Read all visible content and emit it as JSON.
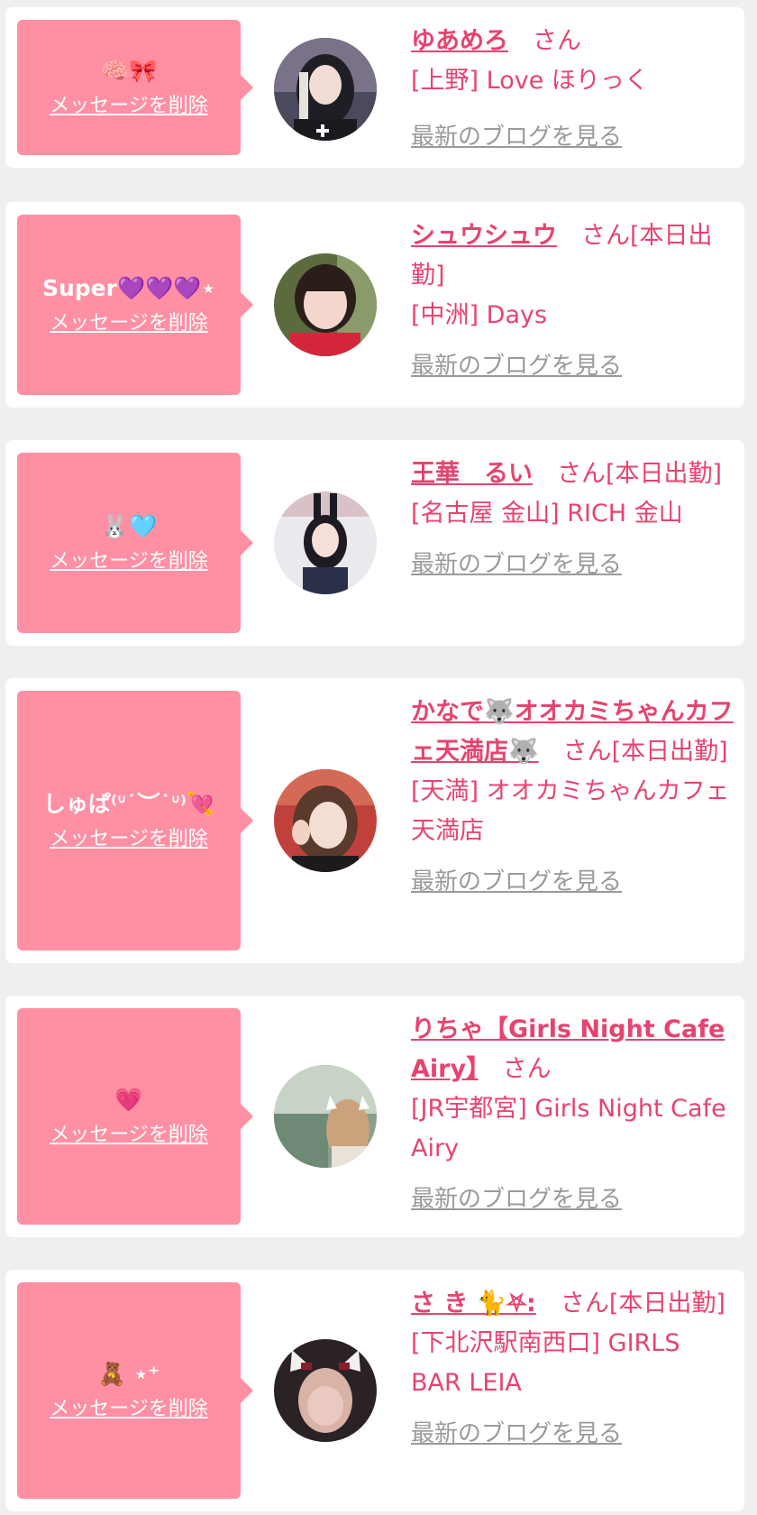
{
  "colors": {
    "background": "#efefef",
    "card": "#ffffff",
    "bubble": "#ff8fa3",
    "accent_text": "#e8436f",
    "link_gray": "#9a9a9a"
  },
  "delete_label": "メッセージを削除",
  "blog_label": "最新のブログを見る",
  "items": [
    {
      "message": "🧠🎀",
      "name": "ゆあめろ",
      "suffix": "　さん",
      "shop": "[上野] Love ほりっく",
      "avatar_icon": "gothic-girl-avatar"
    },
    {
      "message": "Super💜💜💜⋆",
      "name": "シュウシュウ",
      "suffix": "　さん[本日出勤]",
      "shop": "[中洲] Days",
      "avatar_icon": "girl-red-top-avatar"
    },
    {
      "message": "🐰🩵",
      "name": "王華　るい",
      "suffix": "　さん[本日出勤]",
      "shop": "[名古屋 金山] RICH 金山",
      "avatar_icon": "bunny-girl-avatar"
    },
    {
      "message": "しゅぱ⁽ᐡ˙︶˙ᐡ⁾💘",
      "name": "かなで🐺オオカミちゃんカフェ天満店🐺",
      "suffix": "　さん[本日出勤]",
      "shop": "[天満] オオカミちゃんカフェ天満店",
      "avatar_icon": "girl-peace-sign-avatar"
    },
    {
      "message": "💗",
      "name": "りちゃ【Girls Night Cafe Airy】",
      "suffix": "　さん",
      "shop": "[JR宇都宮] Girls Night Cafe Airy",
      "avatar_icon": "cat-ears-girl-avatar"
    },
    {
      "message": "🧸 ⋆⁺",
      "name": "さ き 🐈⛧:",
      "suffix": "　さん[本日出勤]",
      "shop": "[下北沢駅南西口] GIRLS BAR LEIA",
      "avatar_icon": "blurred-girl-avatar"
    }
  ]
}
